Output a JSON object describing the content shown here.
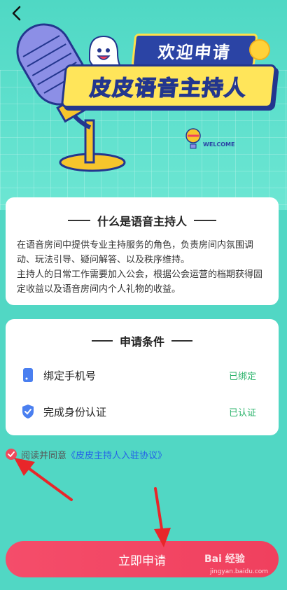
{
  "hero": {
    "banner_line1": "欢迎申请",
    "banner_line2": "皮皮语音主持人",
    "welcome_badge": "WELCOME"
  },
  "what_is": {
    "title": "什么是语音主持人",
    "paragraph1": "在语音房间中提供专业主持服务的角色，负责房间内氛围调动、玩法引导、疑问解答、以及秩序维持。",
    "paragraph2": "主持人的日常工作需要加入公会，根据公会运营的档期获得固定收益以及语音房间内个人礼物的收益。"
  },
  "conditions": {
    "title": "申请条件",
    "items": [
      {
        "label": "绑定手机号",
        "status": "已绑定",
        "icon": "phone-icon"
      },
      {
        "label": "完成身份认证",
        "status": "已认证",
        "icon": "shield-check-icon"
      }
    ]
  },
  "agreement": {
    "prefix": "阅读并同意",
    "link": "《皮皮主持人入驻协议》"
  },
  "apply_button": "立即申请",
  "watermark": {
    "brand": "Bai 经验",
    "url": "jingyan.baidu.com"
  },
  "colors": {
    "accent": "#f0405e",
    "status_green": "#2bb36b",
    "link_blue": "#2463e8",
    "hero_bg": "#51d7c4"
  }
}
